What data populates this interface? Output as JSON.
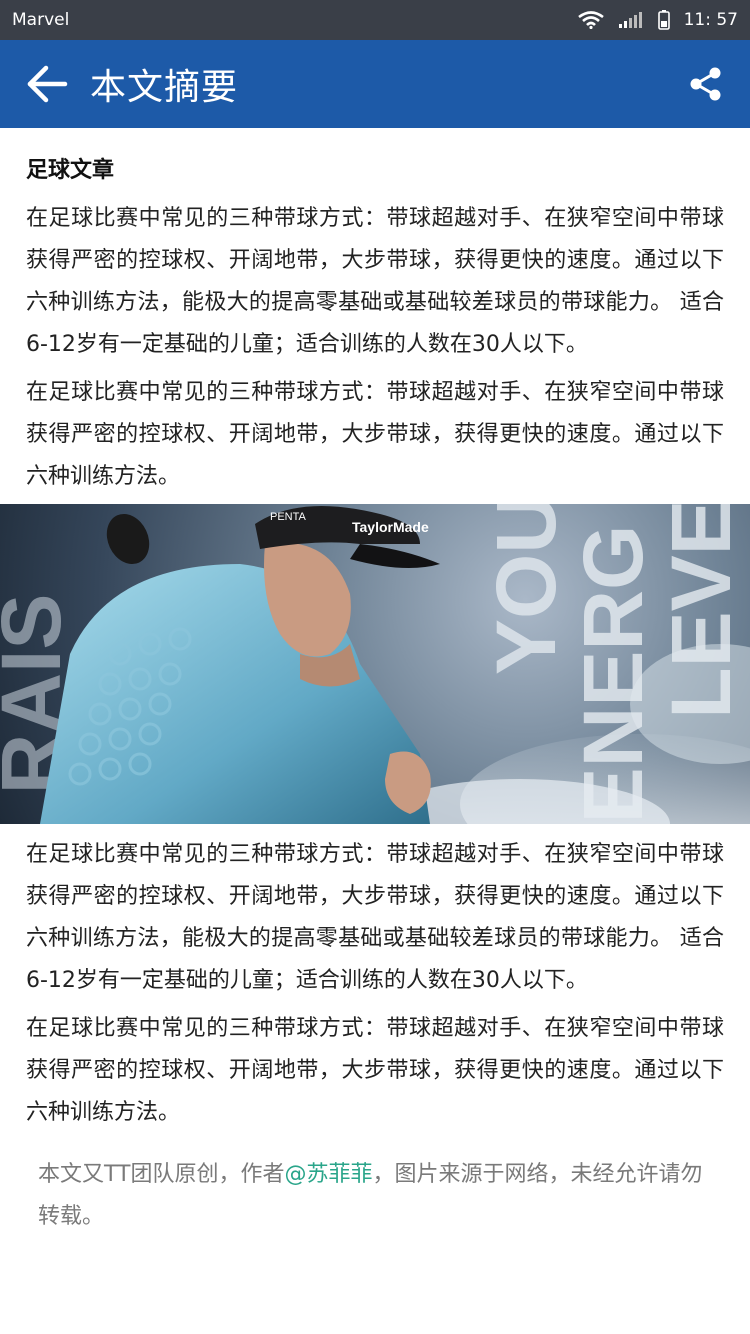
{
  "status_bar": {
    "carrier": "Marvel",
    "time": "11:  57",
    "icons": [
      "wifi-icon",
      "signal-icon",
      "battery-icon"
    ]
  },
  "app_bar": {
    "title": "本文摘要",
    "back_icon": "arrow-left-icon",
    "share_icon": "share-icon"
  },
  "article": {
    "heading": "足球文章",
    "paragraphs_top": [
      "在足球比赛中常见的三种带球方式：带球超越对手、在狭窄空间中带球获得严密的控球权、开阔地带，大步带球，获得更快的速度。通过以下六种训练方法，能极大的提高零基础或基础较差球员的带球能力。 适合6-12岁有一定基础的儿童；适合训练的人数在30人以下。",
      "在足球比赛中常见的三种带球方式：带球超越对手、在狭窄空间中带球获得严密的控球权、开阔地带，大步带球，获得更快的速度。通过以下六种训练方法。"
    ],
    "hero_image": {
      "text_left": "RAIS",
      "text_mid": "YOU",
      "text_right_1": "ENERG",
      "text_right_2": "LEVE",
      "cap_brand": "TaylorMade",
      "cap_front": "PENTA"
    },
    "paragraphs_bottom": [
      "在足球比赛中常见的三种带球方式：带球超越对手、在狭窄空间中带球获得严密的控球权、开阔地带，大步带球，获得更快的速度。通过以下六种训练方法，能极大的提高零基础或基础较差球员的带球能力。 适合6-12岁有一定基础的儿童；适合训练的人数在30人以下。",
      "在足球比赛中常见的三种带球方式：带球超越对手、在狭窄空间中带球获得严密的控球权、开阔地带，大步带球，获得更快的速度。通过以下六种训练方法。"
    ]
  },
  "footer": {
    "prefix": "本文又TT团队原创，作者",
    "author": "@苏菲菲",
    "suffix": "，图片来源于网络，未经允许请勿转载。",
    "author_color": "#2aa58a"
  },
  "colors": {
    "status_bar": "#3a3f48",
    "app_bar": "#1d5aa8"
  }
}
